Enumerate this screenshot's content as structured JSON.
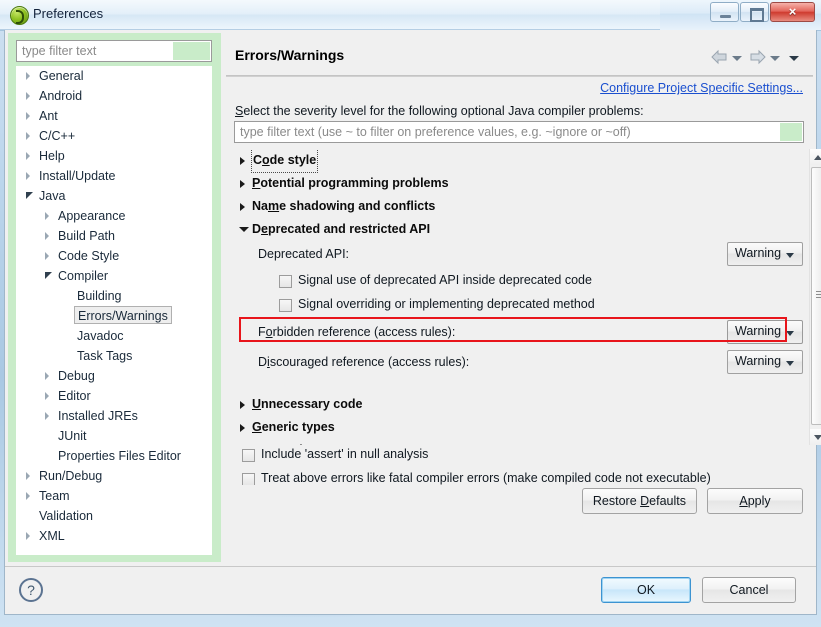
{
  "window": {
    "title": "Preferences",
    "app_icon": "eclipse-icon",
    "minimize_label": "Minimize",
    "maximize_label": "Maximize",
    "close_label": "×"
  },
  "sidebar": {
    "filter": {
      "placeholder": "type filter text",
      "value": ""
    },
    "items": [
      {
        "label": "General",
        "depth": 0,
        "twisty": "closed"
      },
      {
        "label": "Android",
        "depth": 0,
        "twisty": "closed"
      },
      {
        "label": "Ant",
        "depth": 0,
        "twisty": "closed"
      },
      {
        "label": "C/C++",
        "depth": 0,
        "twisty": "closed"
      },
      {
        "label": "Help",
        "depth": 0,
        "twisty": "closed"
      },
      {
        "label": "Install/Update",
        "depth": 0,
        "twisty": "closed"
      },
      {
        "label": "Java",
        "depth": 0,
        "twisty": "open"
      },
      {
        "label": "Appearance",
        "depth": 1,
        "twisty": "closed"
      },
      {
        "label": "Build Path",
        "depth": 1,
        "twisty": "closed"
      },
      {
        "label": "Code Style",
        "depth": 1,
        "twisty": "closed"
      },
      {
        "label": "Compiler",
        "depth": 1,
        "twisty": "open"
      },
      {
        "label": "Building",
        "depth": 2,
        "twisty": "none"
      },
      {
        "label": "Errors/Warnings",
        "depth": 2,
        "twisty": "none",
        "selected": true
      },
      {
        "label": "Javadoc",
        "depth": 2,
        "twisty": "none"
      },
      {
        "label": "Task Tags",
        "depth": 2,
        "twisty": "none"
      },
      {
        "label": "Debug",
        "depth": 1,
        "twisty": "closed"
      },
      {
        "label": "Editor",
        "depth": 1,
        "twisty": "closed"
      },
      {
        "label": "Installed JREs",
        "depth": 1,
        "twisty": "closed"
      },
      {
        "label": "JUnit",
        "depth": 1,
        "twisty": "none"
      },
      {
        "label": "Properties Files Editor",
        "depth": 1,
        "twisty": "none"
      },
      {
        "label": "Run/Debug",
        "depth": 0,
        "twisty": "closed"
      },
      {
        "label": "Team",
        "depth": 0,
        "twisty": "closed"
      },
      {
        "label": "Validation",
        "depth": 0,
        "twisty": "none"
      },
      {
        "label": "XML",
        "depth": 0,
        "twisty": "closed"
      }
    ]
  },
  "main": {
    "title": "Errors/Warnings",
    "nav": {
      "back_icon": "back-arrow-icon",
      "back_menu_icon": "chevron-down-icon",
      "forward_icon": "forward-arrow-icon",
      "forward_menu_icon": "chevron-down-icon",
      "view_menu_icon": "chevron-down-icon"
    },
    "configure_link": "Configure Project Specific Settings...",
    "description_prefix": "S",
    "description_rest": "elect the severity level for the following optional Java compiler problems:",
    "filter": {
      "placeholder": "type filter text (use ~ to filter on preference values, e.g. ~ignore or ~off)",
      "value": ""
    },
    "sections": [
      {
        "label_pre": "C",
        "label_mn": "o",
        "label_post": "de style",
        "state": "collapsed",
        "focused": true
      },
      {
        "label_pre": "",
        "label_mn": "P",
        "label_post": "otential programming problems",
        "state": "collapsed",
        "focused": false
      },
      {
        "label_pre": "Na",
        "label_mn": "m",
        "label_post": "e shadowing and conflicts",
        "state": "collapsed",
        "focused": false
      },
      {
        "label_pre": "D",
        "label_mn": "e",
        "label_post": "precated and restricted API",
        "state": "expanded",
        "focused": false
      }
    ],
    "deprecated_rows": [
      {
        "type": "combo",
        "label": "Deprecated API:",
        "mnemonic": "",
        "value": "Warning",
        "highlight": false
      },
      {
        "type": "checkbox",
        "label": "Signal use of deprecated API inside deprecated code",
        "checked": false
      },
      {
        "type": "checkbox",
        "label": "Signal overriding or implementing deprecated method",
        "checked": false
      },
      {
        "type": "combo",
        "label_pre": "F",
        "label_mn": "o",
        "label_post": "rbidden reference (access rules):",
        "value": "Warning",
        "highlight": true
      },
      {
        "type": "combo",
        "label_pre": "D",
        "label_mn": "i",
        "label_post": "scouraged reference (access rules):",
        "value": "Warning",
        "highlight": false
      }
    ],
    "sections_after": [
      {
        "label_pre": "",
        "label_mn": "U",
        "label_post": "nnecessary code",
        "state": "collapsed"
      },
      {
        "label_pre": "",
        "label_mn": "G",
        "label_post": "eneric types",
        "state": "collapsed"
      },
      {
        "label_pre": "A",
        "label_mn": "n",
        "label_post": "notations",
        "state": "collapsed"
      }
    ],
    "bottom_checkboxes": [
      {
        "label": "Include 'assert' in null analysis",
        "checked": false
      },
      {
        "label": "Treat above errors like fatal compiler errors (make compiled code not executable)",
        "checked": false
      }
    ],
    "restore_pre": "Restore ",
    "restore_mn": "D",
    "restore_post": "efaults",
    "apply_mn": "A",
    "apply_post": "pply",
    "scrollbar": {
      "up_icon": "scroll-up-icon",
      "down_icon": "scroll-down-icon"
    }
  },
  "footer": {
    "help_icon": "?",
    "ok_label": "OK",
    "cancel_label": "Cancel"
  },
  "annotation": {
    "color": "#e8151b",
    "target": "forbidden-reference-row"
  }
}
